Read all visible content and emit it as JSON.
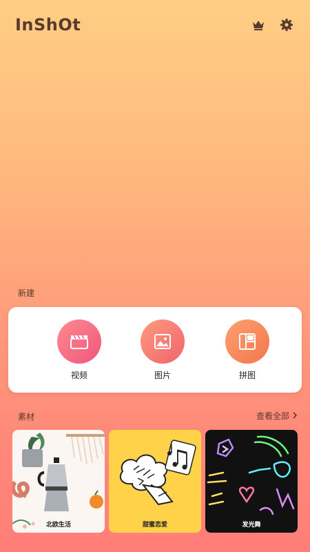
{
  "header": {
    "logo": "InShOt",
    "icons": [
      "crown-icon",
      "gear-icon"
    ]
  },
  "sections": {
    "new_label": "新建",
    "material_label": "素材",
    "view_all": "查看全部"
  },
  "create": [
    {
      "label": "视频",
      "icon": "video-clapper-icon"
    },
    {
      "label": "图片",
      "icon": "image-icon"
    },
    {
      "label": "拼图",
      "icon": "collage-icon"
    }
  ],
  "materials": [
    {
      "title": "北欧生活"
    },
    {
      "title": "甜蜜恋爱"
    },
    {
      "title": "发光舞"
    }
  ],
  "colors": {
    "bg_top": "#FFCE84",
    "bg_bottom": "#FF7E78",
    "logo": "#5a3a2c",
    "card_bg": "#FFFFFF"
  }
}
